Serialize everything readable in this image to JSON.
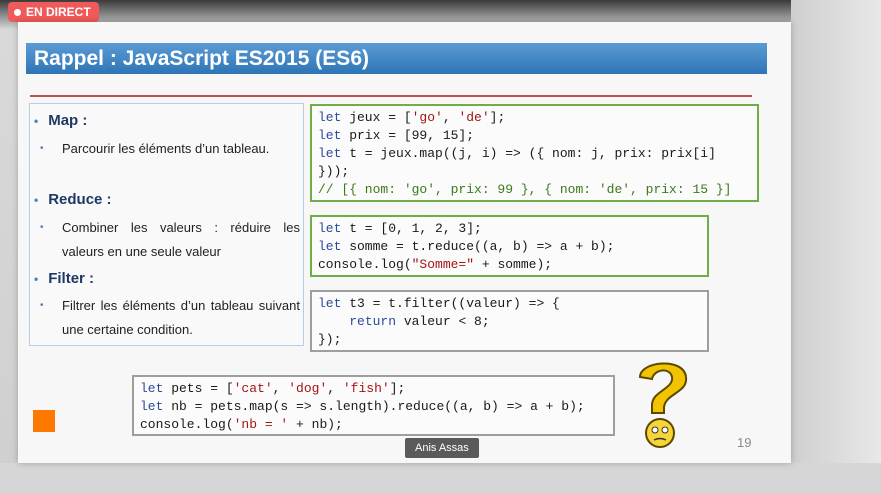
{
  "live_badge": "EN DIRECT",
  "slide": {
    "title": "Rappel : JavaScript ES2015 (ES6)",
    "sections": [
      {
        "heading": "Map :",
        "text": "Parcourir les éléments d’un tableau."
      },
      {
        "heading": "Reduce :",
        "text": "Combiner les valeurs : réduire les valeurs en une seule valeur"
      },
      {
        "heading": "Filter :",
        "text": "Filtrer les éléments d’un tableau suivant une certaine condition."
      }
    ],
    "code_map": [
      "let jeux = ['go', 'de'];",
      "let prix = [99, 15];",
      "let t = jeux.map((j, i) => ({ nom: j, prix: prix[i]",
      "}));",
      "// [{ nom: 'go', prix: 99 }, { nom: 'de', prix: 15 }]"
    ],
    "code_reduce": [
      "let t = [0, 1, 2, 3];",
      "let somme = t.reduce((a, b) => a + b);",
      "console.log(\"Somme=\" + somme);"
    ],
    "code_filter": [
      "let t3 = t.filter((valeur) => {",
      "    return valeur < 8;",
      "});"
    ],
    "code_example": [
      "let pets = ['cat', 'dog', 'fish'];",
      "let nb = pets.map(s => s.length).reduce((a, b) => a + b);",
      "console.log('nb = ' + nb);"
    ],
    "page_number": "19",
    "logo_icon": "orange-logo",
    "mascot_icon": "thinking-question-icon"
  },
  "presenter": "Anis Assas",
  "colors": {
    "title_bar": "#2e75b6",
    "live_badge": "#f05a5a",
    "code_border_green": "#70ad47",
    "code_border_gray": "#9e9e9e",
    "rule": "#c0504d"
  }
}
